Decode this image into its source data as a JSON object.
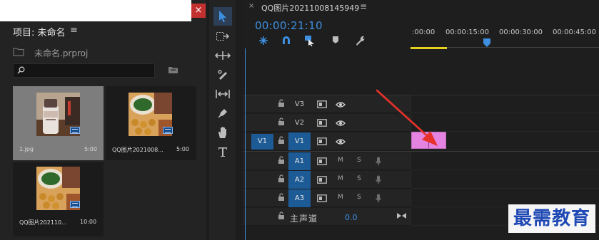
{
  "project": {
    "close_label": "×",
    "title": "项目: 未命名",
    "menu_label": "≡",
    "file_name": "未命名.prproj",
    "search": {
      "value": "",
      "placeholder": ""
    },
    "items": [
      {
        "name": "1.jpg",
        "duration": "5:00",
        "selected": true,
        "thumb": "bottle"
      },
      {
        "name": "QQ图片2021008...",
        "duration": "5:00",
        "selected": false,
        "thumb": "food"
      },
      {
        "name": "QQ图片202110...",
        "duration": "10:00",
        "selected": false,
        "thumb": "food"
      }
    ]
  },
  "tools": [
    {
      "name": "selection-tool",
      "active": true
    },
    {
      "name": "track-select-tool",
      "active": false
    },
    {
      "name": "ripple-edit-tool",
      "active": false
    },
    {
      "name": "razor-tool",
      "active": false
    },
    {
      "name": "slip-tool",
      "active": false
    },
    {
      "name": "pen-tool",
      "active": false
    },
    {
      "name": "hand-tool",
      "active": false
    },
    {
      "name": "type-tool",
      "active": false
    }
  ],
  "timeline": {
    "close_label": "×",
    "sequence_name": "QQ图片20211008145949",
    "menu_label": "≡",
    "timecode": "00:00:21:10",
    "ruler_ticks": [
      ":00:00",
      "00:00:15:00",
      "00:00:30:00",
      "00:00:45:00"
    ],
    "video_tracks": [
      {
        "name": "V3",
        "source": "",
        "source_on": false,
        "target_on": false
      },
      {
        "name": "V2",
        "source": "",
        "source_on": false,
        "target_on": false
      },
      {
        "name": "V1",
        "source": "V1",
        "source_on": true,
        "target_on": true
      }
    ],
    "audio_tracks": [
      {
        "name": "A1",
        "mute": "M",
        "solo": "S"
      },
      {
        "name": "A2",
        "mute": "M",
        "solo": "S"
      },
      {
        "name": "A3",
        "mute": "M",
        "solo": "S"
      }
    ],
    "master": {
      "label": "主声道",
      "value": "0.0"
    }
  },
  "colors": {
    "accent": "#3e8fe0",
    "track_target": "#1d5b96",
    "clip": "#e483e0",
    "inout_bar": "#e6d21a",
    "close_button": "#c2312f",
    "annotation_arrow": "#e8312b",
    "watermark_text": "#1e48b4"
  },
  "watermark": {
    "text": "最需教育"
  }
}
